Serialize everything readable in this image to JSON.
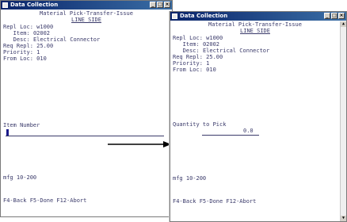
{
  "window1": {
    "title": "Data Collection",
    "controls": [
      "_",
      "□",
      "×"
    ],
    "header": "Material Pick-Transfer-Issue",
    "subheader": "LINE_SIDE",
    "fields": [
      {
        "label": "Repl Loc:",
        "value": "w1000"
      },
      {
        "label": "   Item:",
        "value": "02002"
      },
      {
        "label": "   Desc:",
        "value": "Electrical Connector"
      },
      {
        "label": "Req Repl:",
        "value": "25.00"
      },
      {
        "label": "Priority:",
        "value": "1"
      },
      {
        "label": "From Loc:",
        "value": "010"
      }
    ],
    "prompt": "Item Number",
    "input_value": "",
    "context": "mfg 10-200",
    "function_keys": "F4-Back F5-Done F12-Abort"
  },
  "window2": {
    "title": "Data Collection",
    "controls": [
      "_",
      "□",
      "×"
    ],
    "header": "Material Pick-Transfer-Issue",
    "subheader": "LINE_SIDE",
    "fields": [
      {
        "label": "Repl Loc:",
        "value": "w1000"
      },
      {
        "label": "   Item:",
        "value": "02002"
      },
      {
        "label": "   Desc:",
        "value": "Electrical Connector"
      },
      {
        "label": "Req Repl:",
        "value": "25.00"
      },
      {
        "label": "Priority:",
        "value": "1"
      },
      {
        "label": "From Loc:",
        "value": "010"
      }
    ],
    "prompt": "Quantity to Pick",
    "input_value": "0.0",
    "context": "mfg 10-200",
    "function_keys": "F4-Back F5-Done F12-Abort"
  },
  "colors": {
    "text": "#3a3a6a",
    "titlebar": "#0a246a",
    "cursor": "#1a1a8a"
  },
  "arrow_icon": "right-arrow-icon"
}
